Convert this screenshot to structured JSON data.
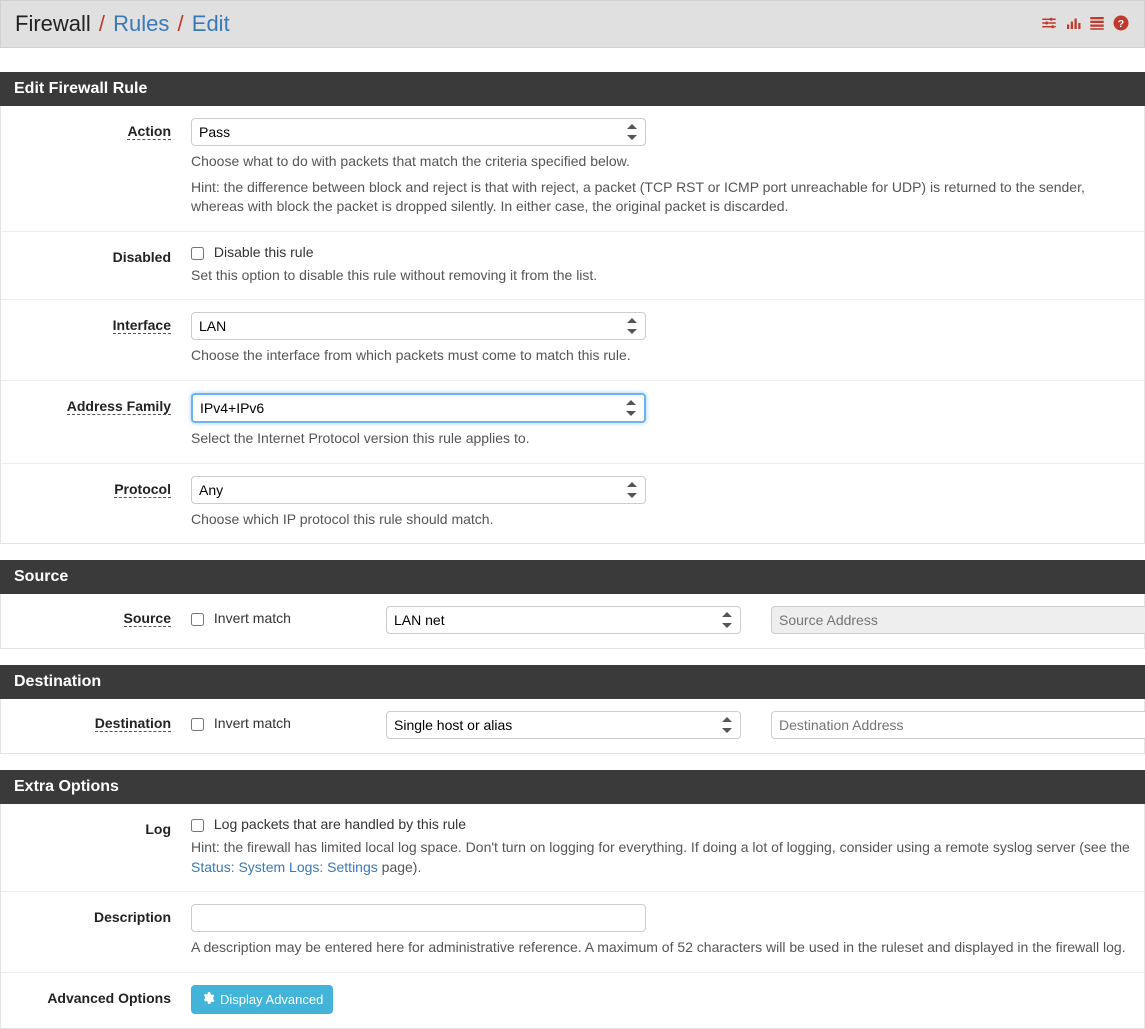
{
  "breadcrumb": {
    "root": "Firewall",
    "mid": "Rules",
    "leaf": "Edit"
  },
  "panels": {
    "edit": "Edit Firewall Rule",
    "source": "Source",
    "destination": "Destination",
    "extra": "Extra Options"
  },
  "labels": {
    "action": "Action",
    "disabled": "Disabled",
    "interface": "Interface",
    "address_family": "Address Family",
    "protocol": "Protocol",
    "source": "Source",
    "destination": "Destination",
    "log": "Log",
    "description": "Description",
    "advanced_options": "Advanced Options"
  },
  "fields": {
    "action": {
      "value": "Pass",
      "help1": "Choose what to do with packets that match the criteria specified below.",
      "help2": "Hint: the difference between block and reject is that with reject, a packet (TCP RST or ICMP port unreachable for UDP) is returned to the sender, whereas with block the packet is dropped silently. In either case, the original packet is discarded."
    },
    "disabled": {
      "label": "Disable this rule",
      "help": "Set this option to disable this rule without removing it from the list."
    },
    "interface": {
      "value": "LAN",
      "help": "Choose the interface from which packets must come to match this rule."
    },
    "address_family": {
      "value": "IPv4+IPv6",
      "help": "Select the Internet Protocol version this rule applies to."
    },
    "protocol": {
      "value": "Any",
      "help": "Choose which IP protocol this rule should match."
    },
    "source": {
      "invert_label": "Invert match",
      "type_value": "LAN net",
      "addr_placeholder": "Source Address",
      "mask_sep": "/"
    },
    "destination": {
      "invert_label": "Invert match",
      "type_value": "Single host or alias",
      "addr_placeholder": "Destination Address",
      "mask_sep": "/"
    },
    "log": {
      "label": "Log packets that are handled by this rule",
      "help_prefix": "Hint: the firewall has limited local log space. Don't turn on logging for everything. If doing a lot of logging, consider using a remote syslog server (see the ",
      "help_link": "Status: System Logs: Settings",
      "help_suffix": " page)."
    },
    "description": {
      "value": "",
      "help": "A description may be entered here for administrative reference. A maximum of 52 characters will be used in the ruleset and displayed in the firewall log."
    },
    "advanced": {
      "button": "Display Advanced"
    }
  }
}
